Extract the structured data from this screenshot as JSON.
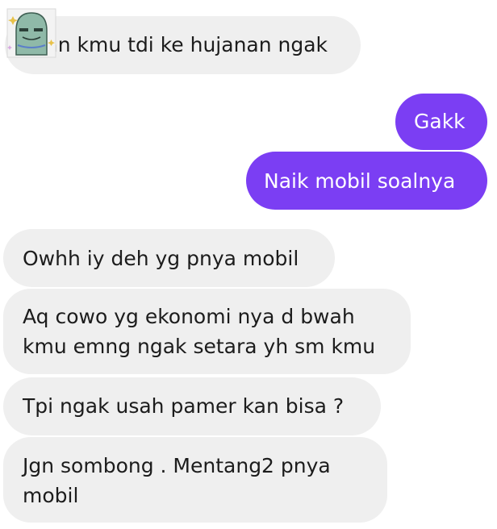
{
  "conversation": {
    "messages": [
      {
        "sender": "them",
        "text": "Gmn kmu tdi ke hujanan ngak"
      },
      {
        "sender": "me",
        "text": "Gakk"
      },
      {
        "sender": "me",
        "text": "Naik mobil soalnya"
      },
      {
        "sender": "them",
        "text": "Owhh iy deh yg pnya mobil"
      },
      {
        "sender": "them",
        "lines": [
          "Aq cowo yg ekonomi nya d bwah",
          "kmu emng ngak setara yh sm kmu"
        ]
      },
      {
        "sender": "them",
        "text": "Tpi ngak usah pamer kan bisa ?"
      },
      {
        "sender": "them",
        "lines": [
          "Jgn sombong . Mentang2 pnya",
          "mobil"
        ]
      }
    ]
  },
  "colors": {
    "incoming_bubble": "#efefef",
    "outgoing_bubble": "#7b3ef3",
    "incoming_text": "#1c1c1c",
    "outgoing_text": "#ffffff"
  },
  "icons": {
    "sticker": "ghost-sticker-icon"
  }
}
